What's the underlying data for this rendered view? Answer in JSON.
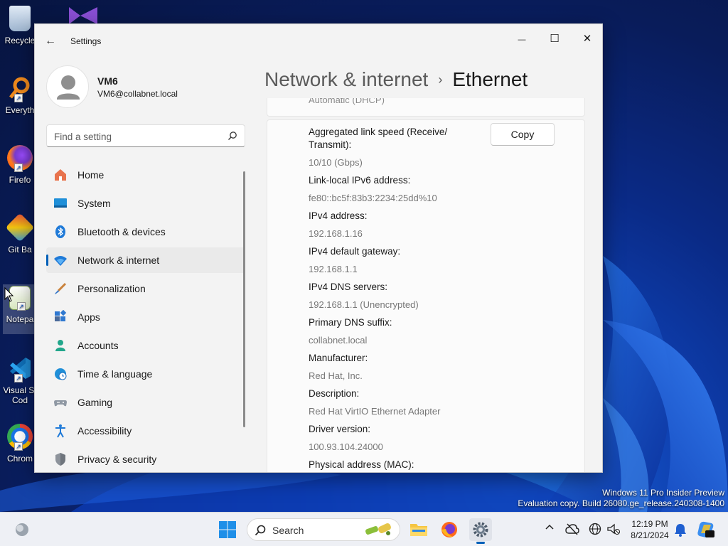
{
  "desktop": {
    "icons": [
      {
        "name": "recycle-bin",
        "label": "Recycle"
      },
      {
        "name": "everything",
        "label": "Everyth"
      },
      {
        "name": "firefox",
        "label": "Firefo"
      },
      {
        "name": "git-bash",
        "label": "Git Ba"
      },
      {
        "name": "notepad",
        "label": "Notepa"
      },
      {
        "name": "vscode",
        "label": "Visual St Cod"
      },
      {
        "name": "chrome",
        "label": "Chrom"
      }
    ],
    "watermark_line1": "Windows 11 Pro Insider Preview",
    "watermark_line2": "Evaluation copy. Build 26080.ge_release.240308-1400"
  },
  "window": {
    "app_title": "Settings",
    "back_glyph": "←",
    "minimize_glyph": "—",
    "maximize_glyph": "☐",
    "close_glyph": "✕"
  },
  "profile": {
    "name": "VM6",
    "email": "VM6@collabnet.local"
  },
  "search": {
    "placeholder": "Find a setting"
  },
  "nav": {
    "items": [
      {
        "label": "Home",
        "icon": "home-icon"
      },
      {
        "label": "System",
        "icon": "system-icon"
      },
      {
        "label": "Bluetooth & devices",
        "icon": "bluetooth-icon"
      },
      {
        "label": "Network & internet",
        "icon": "wifi-icon",
        "active": true
      },
      {
        "label": "Personalization",
        "icon": "brush-icon"
      },
      {
        "label": "Apps",
        "icon": "apps-icon"
      },
      {
        "label": "Accounts",
        "icon": "person-icon"
      },
      {
        "label": "Time & language",
        "icon": "globe-clock-icon"
      },
      {
        "label": "Gaming",
        "icon": "gamepad-icon"
      },
      {
        "label": "Accessibility",
        "icon": "accessibility-icon"
      },
      {
        "label": "Privacy & security",
        "icon": "shield-icon"
      }
    ]
  },
  "header": {
    "parent": "Network & internet",
    "separator": "›",
    "current": "Ethernet"
  },
  "content": {
    "partial_top_value": "Automatic (DHCP)",
    "copy_label": "Copy",
    "properties": [
      {
        "label": "Aggregated link speed (Receive/ Transmit):",
        "value": "10/10 (Gbps)"
      },
      {
        "label": "Link-local IPv6 address:",
        "value": "fe80::bc5f:83b3:2234:25dd%10"
      },
      {
        "label": "IPv4 address:",
        "value": "192.168.1.16"
      },
      {
        "label": "IPv4 default gateway:",
        "value": "192.168.1.1"
      },
      {
        "label": "IPv4 DNS servers:",
        "value": "192.168.1.1 (Unencrypted)"
      },
      {
        "label": "Primary DNS suffix:",
        "value": "collabnet.local"
      },
      {
        "label": "Manufacturer:",
        "value": "Red Hat, Inc."
      },
      {
        "label": "Description:",
        "value": "Red Hat VirtIO Ethernet Adapter"
      },
      {
        "label": "Driver version:",
        "value": "100.93.104.24000"
      },
      {
        "label": "Physical address (MAC):",
        "value": ""
      }
    ]
  },
  "taskbar": {
    "search_label": "Search",
    "time": "12:19 PM",
    "date": "8/21/2024"
  },
  "colors": {
    "accent": "#005fb8",
    "window_bg": "#f3f3f3",
    "card_bg": "#fbfbfb"
  }
}
